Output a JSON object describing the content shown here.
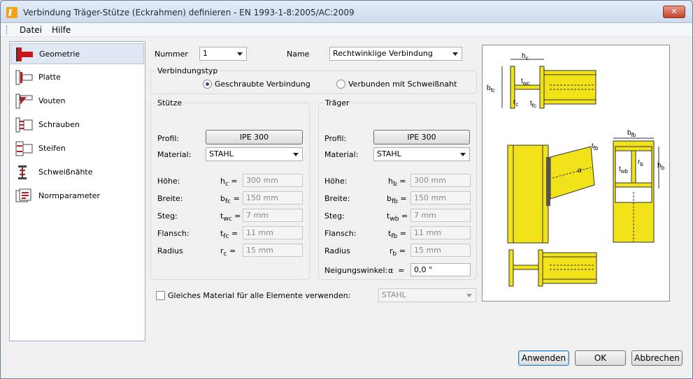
{
  "window": {
    "title": "Verbindung Träger-Stütze (Eckrahmen) definieren - EN 1993-1-8:2005/AC:2009",
    "close": "✕"
  },
  "menu": {
    "file": "Datei",
    "help": "Hilfe"
  },
  "sidebar": {
    "items": [
      {
        "label": "Geometrie",
        "icon": "geometry-icon"
      },
      {
        "label": "Platte",
        "icon": "plate-icon"
      },
      {
        "label": "Vouten",
        "icon": "haunch-icon"
      },
      {
        "label": "Schrauben",
        "icon": "bolts-icon"
      },
      {
        "label": "Steifen",
        "icon": "stiffener-icon"
      },
      {
        "label": "Schweißnähte",
        "icon": "weld-icon"
      },
      {
        "label": "Normparameter",
        "icon": "code-parameters-icon"
      }
    ]
  },
  "form": {
    "number_label": "Nummer",
    "number_value": "1",
    "name_label": "Name",
    "name_value": "Rechtwinklige Verbindung",
    "conn_type_label": "Verbindungstyp",
    "radio_bolted": "Geschraubte Verbindung",
    "radio_welded": "Verbunden mit Schweißnaht",
    "column": {
      "title": "Stütze",
      "profile_label": "Profil:",
      "profile_value": "IPE 300",
      "material_label": "Material:",
      "material_value": "STAHL",
      "rows": [
        {
          "label": "Höhe:",
          "sym": "h",
          "sub": "c",
          "value": "300 mm"
        },
        {
          "label": "Breite:",
          "sym": "b",
          "sub": "fc",
          "value": "150 mm"
        },
        {
          "label": "Steg:",
          "sym": "t",
          "sub": "wc",
          "value": "7 mm"
        },
        {
          "label": "Flansch:",
          "sym": "t",
          "sub": "fc",
          "value": "11 mm"
        },
        {
          "label": "Radius",
          "sym": "r",
          "sub": "c",
          "value": "15 mm"
        }
      ]
    },
    "beam": {
      "title": "Träger",
      "profile_label": "Profil:",
      "profile_value": "IPE 300",
      "material_label": "Material:",
      "material_value": "STAHL",
      "rows": [
        {
          "label": "Höhe:",
          "sym": "h",
          "sub": "b",
          "value": "300 mm"
        },
        {
          "label": "Breite:",
          "sym": "b",
          "sub": "fb",
          "value": "150 mm"
        },
        {
          "label": "Steg:",
          "sym": "t",
          "sub": "wb",
          "value": "7 mm"
        },
        {
          "label": "Flansch:",
          "sym": "t",
          "sub": "fb",
          "value": "11 mm"
        },
        {
          "label": "Radius",
          "sym": "r",
          "sub": "b",
          "value": "15 mm"
        }
      ],
      "angle_label": "Neigungswinkel:",
      "angle_sym": "α",
      "angle_value": "0,0 °"
    },
    "same_material_label": "Gleiches Material für alle Elemente verwenden:",
    "same_material_value": "STAHL"
  },
  "diagram": {
    "hc": "h",
    "hc_sub": "c",
    "bfc": "b",
    "bfc_sub": "fc",
    "twc": "t",
    "twc_sub": "wc",
    "rc": "r",
    "rc_sub": "c",
    "tfc": "t",
    "tfc_sub": "fc",
    "alpha": "α",
    "bfb": "b",
    "bfb_sub": "fb",
    "tfb": "t",
    "tfb_sub": "fb",
    "hb": "h",
    "hb_sub": "b",
    "twb": "t",
    "twb_sub": "wb",
    "rb": "r",
    "rb_sub": "b"
  },
  "buttons": {
    "apply": "Anwenden",
    "ok": "OK",
    "cancel": "Abbrechen"
  },
  "colors": {
    "steel": "#f2e21a",
    "steel_edge": "#3a3a1a",
    "accent": "#c8161d"
  }
}
